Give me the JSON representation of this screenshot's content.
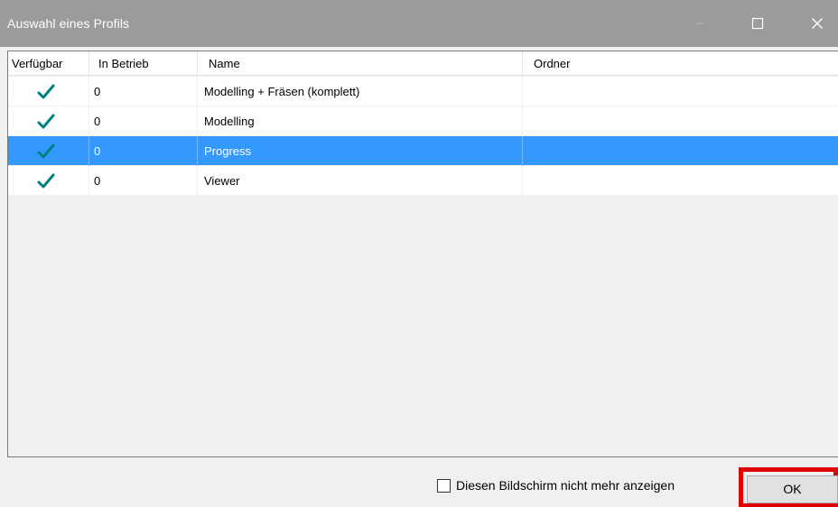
{
  "window": {
    "title": "Auswahl eines Profils",
    "controls": [
      "minimize-icon",
      "maximize-icon",
      "close-icon"
    ]
  },
  "table": {
    "columns": [
      "Verfügbar",
      "In Betrieb",
      "Name",
      "Ordner"
    ],
    "rows": [
      {
        "available_icon": "checkmark-icon",
        "in_betrieb": "0",
        "name": "Modelling + Fräsen (komplett)",
        "ordner": "",
        "selected": false
      },
      {
        "available_icon": "checkmark-icon",
        "in_betrieb": "0",
        "name": "Modelling",
        "ordner": "",
        "selected": false
      },
      {
        "available_icon": "checkmark-icon",
        "in_betrieb": "0",
        "name": "Progress",
        "ordner": "",
        "selected": true
      },
      {
        "available_icon": "checkmark-icon",
        "in_betrieb": "0",
        "name": "Viewer",
        "ordner": "",
        "selected": false
      }
    ]
  },
  "footer": {
    "checkbox_label": "Diesen Bildschirm nicht mehr anzeigen",
    "checkbox_checked": false,
    "ok_label": "OK"
  },
  "colors": {
    "titlebar": "#9b9b9b",
    "selection": "#3399ff",
    "checkmark": "#008080",
    "highlight_outline": "#e00000"
  }
}
